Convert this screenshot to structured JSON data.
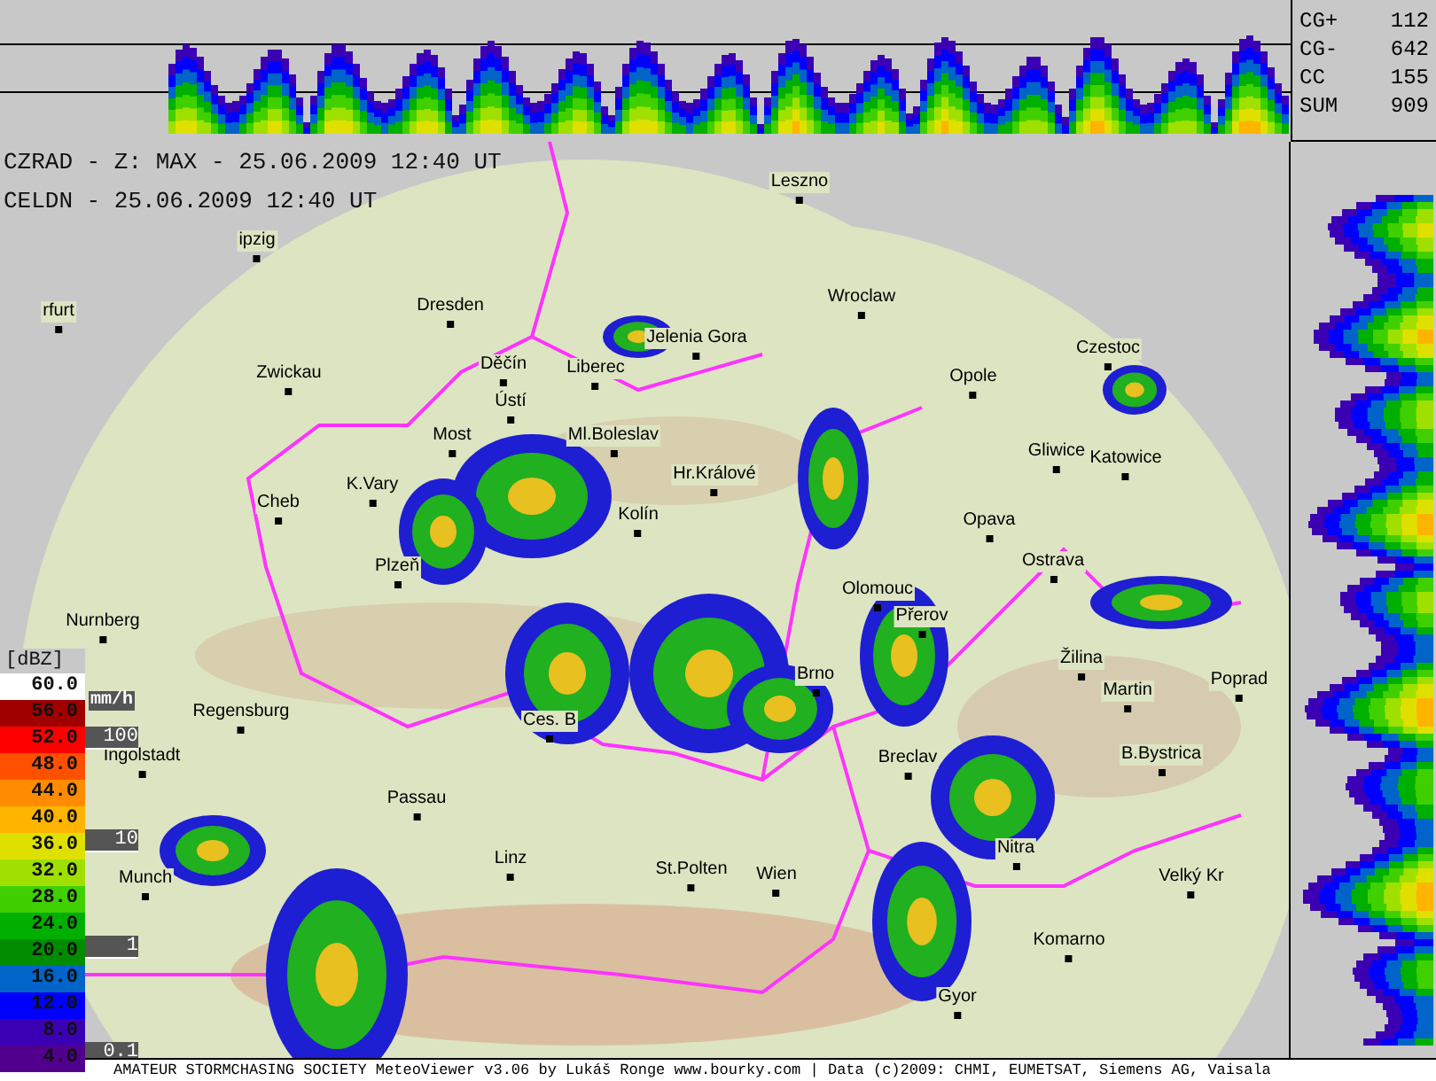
{
  "lightning_stats": [
    {
      "label": "CG+",
      "value": "112"
    },
    {
      "label": "CG-",
      "value": "642"
    },
    {
      "label": "CC",
      "value": "155"
    },
    {
      "label": "SUM",
      "value": "909"
    }
  ],
  "radar_header": {
    "lines": [
      "CZRAD - Z: MAX - 25.06.2009 12:40 UT",
      "CELDN - 25.06.2009 12:40 UT"
    ]
  },
  "map": {
    "cities": [
      {
        "name": "Leszno"
      },
      {
        "name": "ipzig"
      },
      {
        "name": "rfurt"
      },
      {
        "name": "Dresden"
      },
      {
        "name": "Zwickau"
      },
      {
        "name": "Wroclaw"
      },
      {
        "name": "Opole"
      },
      {
        "name": "Czestoc"
      },
      {
        "name": "Jelenia Gora"
      },
      {
        "name": "Děčín"
      },
      {
        "name": "Liberec"
      },
      {
        "name": "Ústí"
      },
      {
        "name": "Ml.Boleslav"
      },
      {
        "name": "Most"
      },
      {
        "name": "K.Vary"
      },
      {
        "name": "Cheb"
      },
      {
        "name": "Hr.Králové"
      },
      {
        "name": "Kolín"
      },
      {
        "name": "Gliwice"
      },
      {
        "name": "Katowice"
      },
      {
        "name": "Opava"
      },
      {
        "name": "Ostrava"
      },
      {
        "name": "Plzeň"
      },
      {
        "name": "Olomouc"
      },
      {
        "name": "Přerov"
      },
      {
        "name": "Nurnberg"
      },
      {
        "name": "Žilina"
      },
      {
        "name": "Martin"
      },
      {
        "name": "Poprad"
      },
      {
        "name": "Regensburg"
      },
      {
        "name": "Ingolstadt"
      },
      {
        "name": "Brno"
      },
      {
        "name": "Ces. B"
      },
      {
        "name": "Breclav"
      },
      {
        "name": "B.Bystrica"
      },
      {
        "name": "Passau"
      },
      {
        "name": "Linz"
      },
      {
        "name": "St.Polten"
      },
      {
        "name": "Wien"
      },
      {
        "name": "Nitra"
      },
      {
        "name": "Velký Kr"
      },
      {
        "name": "Komarno"
      },
      {
        "name": "Gyor"
      },
      {
        "name": "Munch"
      }
    ]
  },
  "legend": {
    "unit": "[dBZ]",
    "levels": [
      {
        "value": "60.0",
        "color": "#ffffff"
      },
      {
        "value": "56.0",
        "color": "#a00000"
      },
      {
        "value": "52.0",
        "color": "#ff0000"
      },
      {
        "value": "48.0",
        "color": "#ff5000"
      },
      {
        "value": "44.0",
        "color": "#ff8c00"
      },
      {
        "value": "40.0",
        "color": "#ffb400"
      },
      {
        "value": "36.0",
        "color": "#e0e000"
      },
      {
        "value": "32.0",
        "color": "#a0e000"
      },
      {
        "value": "28.0",
        "color": "#40d000"
      },
      {
        "value": "24.0",
        "color": "#00b000"
      },
      {
        "value": "20.0",
        "color": "#008c00"
      },
      {
        "value": "16.0",
        "color": "#0064c8"
      },
      {
        "value": "12.0",
        "color": "#0000ff"
      },
      {
        "value": "8.0",
        "color": "#3c00b4"
      },
      {
        "value": "4.0",
        "color": "#50008c"
      }
    ],
    "rain_unit": "mm/h",
    "rain_rates": [
      "100",
      "10",
      "1",
      "0.1"
    ]
  },
  "footer": "AMATEUR STORMCHASING SOCIETY MeteoViewer v3.06 by Lukáš Ronge www.bourky.com | Data (c)2009: CHMI, EUMETSAT, Siemens AG, Vaisala"
}
